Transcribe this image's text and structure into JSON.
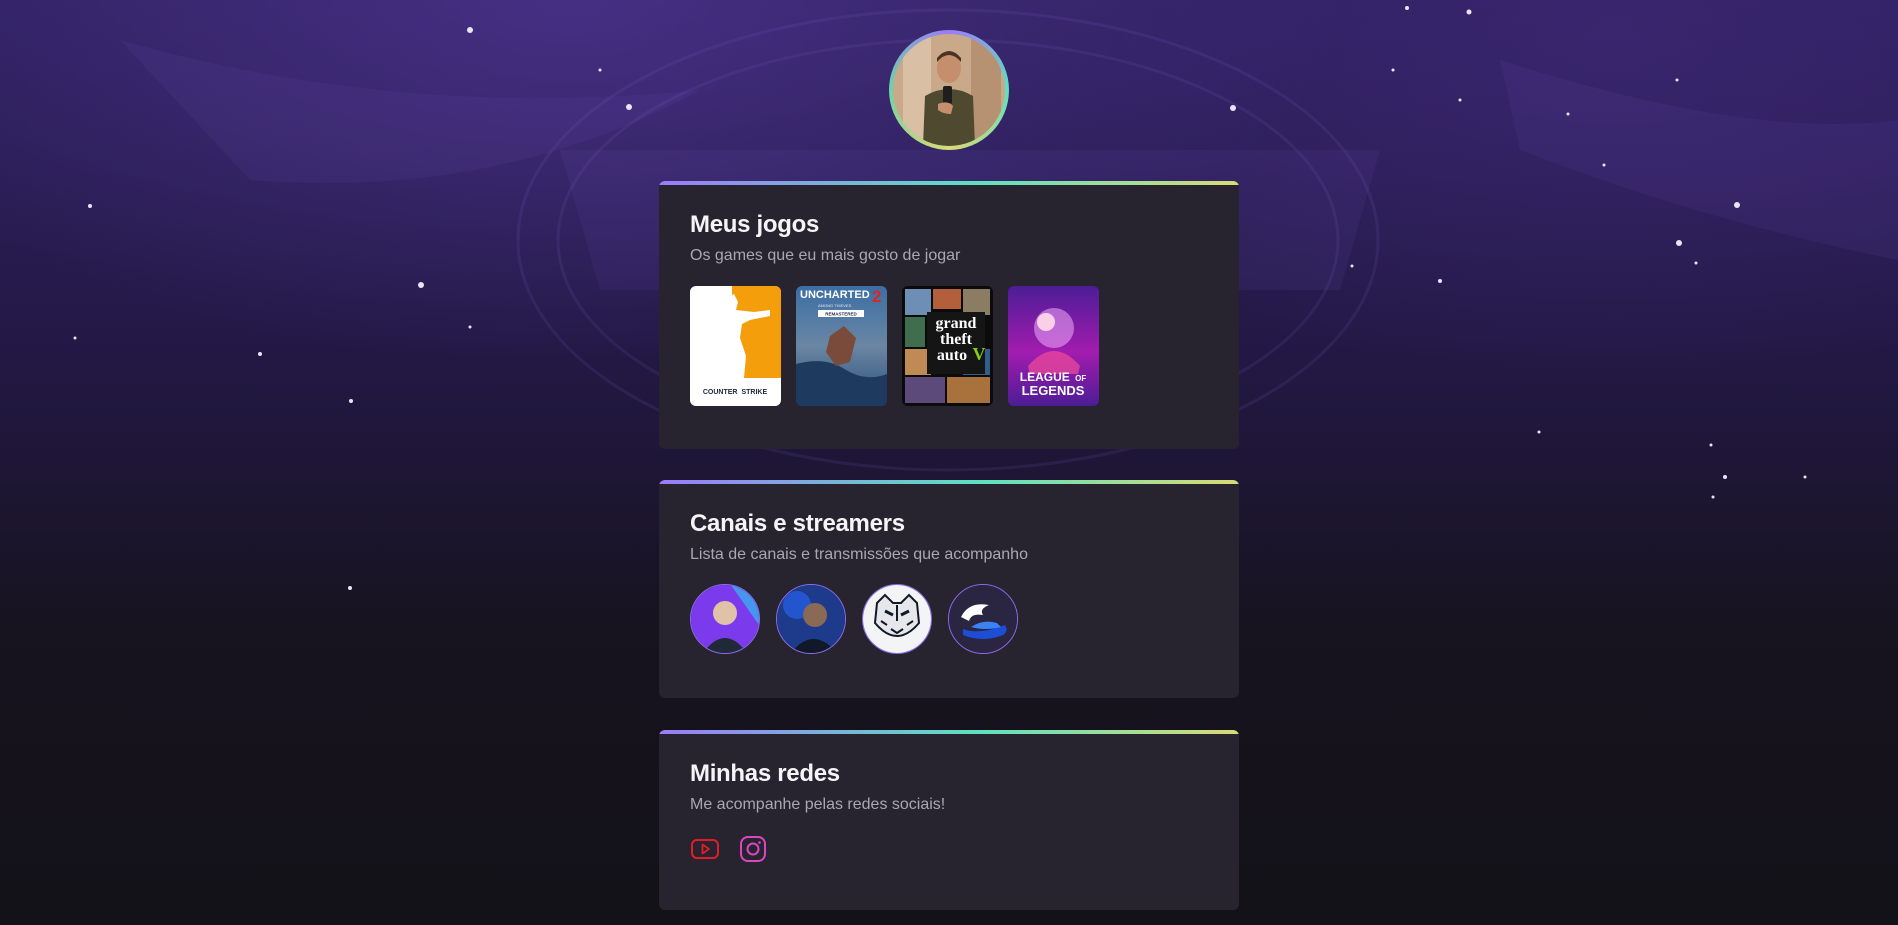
{
  "profile": {
    "avatar_icon": "profile-photo"
  },
  "sections": {
    "games": {
      "title": "Meus jogos",
      "subtitle": "Os games que eu mais gosto de jogar",
      "items": [
        {
          "name": "Counter Strike",
          "logo_text_1": "COUNTER",
          "logo_text_2": "STRIKE"
        },
        {
          "name": "Uncharted 2",
          "logo_text_1": "UNCHARTED",
          "logo_text_2": "2",
          "logo_text_3": "AMONG THIEVES",
          "logo_text_4": "REMASTERED"
        },
        {
          "name": "Grand Theft Auto V",
          "logo_text_1": "grand",
          "logo_text_2": "theft",
          "logo_text_3": "auto",
          "logo_text_4": "V"
        },
        {
          "name": "League of Legends",
          "logo_text_1": "LEAGUE",
          "logo_text_2": "OF",
          "logo_text_3": "LEGENDS"
        }
      ]
    },
    "channels": {
      "title": "Canais e streamers",
      "subtitle": "Lista de canais e transmissões que acompanho",
      "items": [
        {
          "icon": "streamer-avatar-1"
        },
        {
          "icon": "streamer-avatar-2"
        },
        {
          "icon": "tiger-logo"
        },
        {
          "icon": "winged-shoe-logo"
        }
      ]
    },
    "socials": {
      "title": "Minhas redes",
      "subtitle": "Me acompanhe pelas redes sociais!",
      "items": [
        {
          "icon": "youtube-icon",
          "color": "#e11d2a"
        },
        {
          "icon": "instagram-icon",
          "color": "#d946c0"
        }
      ]
    }
  },
  "colors": {
    "gradient_start": "#9b7cf6",
    "gradient_mid": "#5ee0c1",
    "gradient_end": "#d8db75",
    "card_bg": "#27232f"
  }
}
